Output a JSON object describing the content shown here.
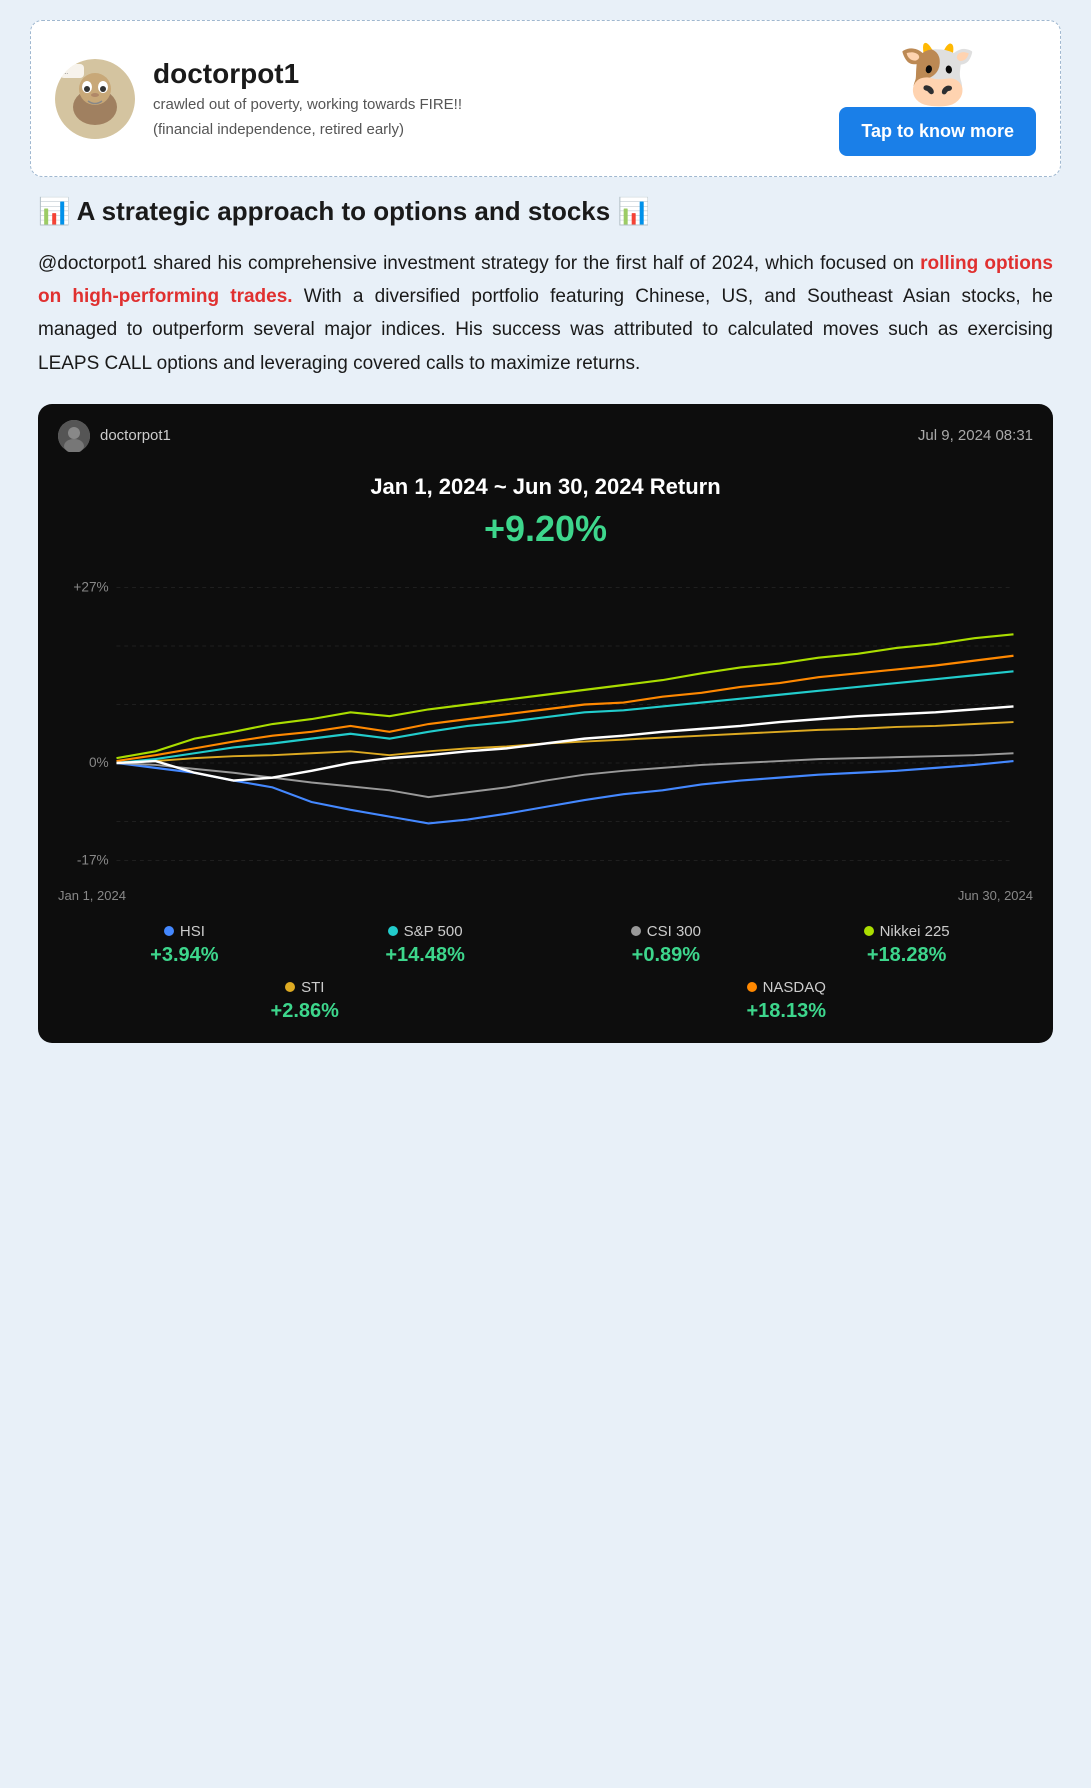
{
  "profile": {
    "username": "doctorpot1",
    "bio_line1": "crawled out of poverty, working towards FIRE!!",
    "bio_line2": "(financial independence, retired early)",
    "tap_button_label": "Tap to know more",
    "avatar_emoji": "🐾"
  },
  "article": {
    "title_icon_left": "📊",
    "title_text": "A strategic approach to options and stocks",
    "title_icon_right": "📊",
    "body_part1": "@doctorpot1 shared his comprehensive investment strategy for the first half of 2024, which focused on ",
    "body_highlight": "rolling options on high-performing trades.",
    "body_part2": " With a diversified portfolio featuring Chinese, US, and Southeast Asian stocks, he managed to outperform several major indices. His success was attributed to calculated moves such as exercising LEAPS CALL options and leveraging covered calls to maximize returns."
  },
  "chart": {
    "author": "doctorpot1",
    "timestamp": "Jul 9, 2024 08:31",
    "title": "Jan 1, 2024 ~ Jun 30, 2024 Return",
    "return_value": "+9.20%",
    "y_axis_top": "+27.00%",
    "y_axis_bottom": "-17.06%",
    "x_axis_start": "Jan 1, 2024",
    "x_axis_end": "Jun 30, 2024",
    "legend": [
      {
        "name": "HSI",
        "color": "#4488ff",
        "value": "+3.94%"
      },
      {
        "name": "S&P 500",
        "color": "#22cccc",
        "value": "+14.48%"
      },
      {
        "name": "CSI 300",
        "color": "#999999",
        "value": "+0.89%"
      },
      {
        "name": "Nikkei 225",
        "color": "#aadd00",
        "value": "+18.28%"
      },
      {
        "name": "STI",
        "color": "#ddaa22",
        "value": "+2.86%"
      },
      {
        "name": "NASDAQ",
        "color": "#ff8800",
        "value": "+18.13%"
      }
    ]
  }
}
